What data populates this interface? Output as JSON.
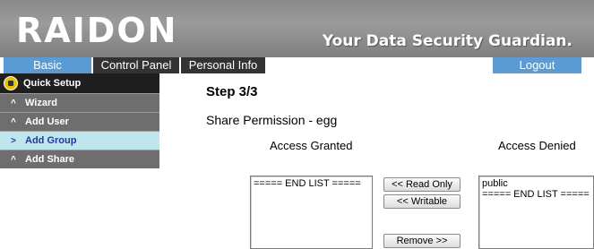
{
  "header": {
    "logo": "RAIDON",
    "tagline": "Your Data Security Guardian."
  },
  "nav": {
    "basic": "Basic",
    "control_panel": "Control Panel",
    "personal_info": "Personal Info",
    "logout": "Logout"
  },
  "sidebar": {
    "heading": "Quick Setup",
    "items": [
      {
        "label": "Wizard",
        "chevron": "^"
      },
      {
        "label": "Add User",
        "chevron": "^"
      },
      {
        "label": "Add Group",
        "chevron": ">"
      },
      {
        "label": "Add Share",
        "chevron": "^"
      }
    ],
    "active_item": "Add Group"
  },
  "main": {
    "step": "Step 3/3",
    "share_permission": "Share Permission - egg",
    "granted_label": "Access Granted",
    "denied_label": "Access Denied",
    "granted_list": [
      "===== END LIST ====="
    ],
    "denied_list": [
      "public",
      "===== END LIST ====="
    ],
    "buttons": {
      "read_only": "<< Read Only",
      "writable": "<< Writable",
      "remove": "Remove >>"
    }
  },
  "colors": {
    "nav_blue": "#5b9bd5",
    "nav_dark": "#333333",
    "sidebar_active": "#bfe6ee"
  }
}
